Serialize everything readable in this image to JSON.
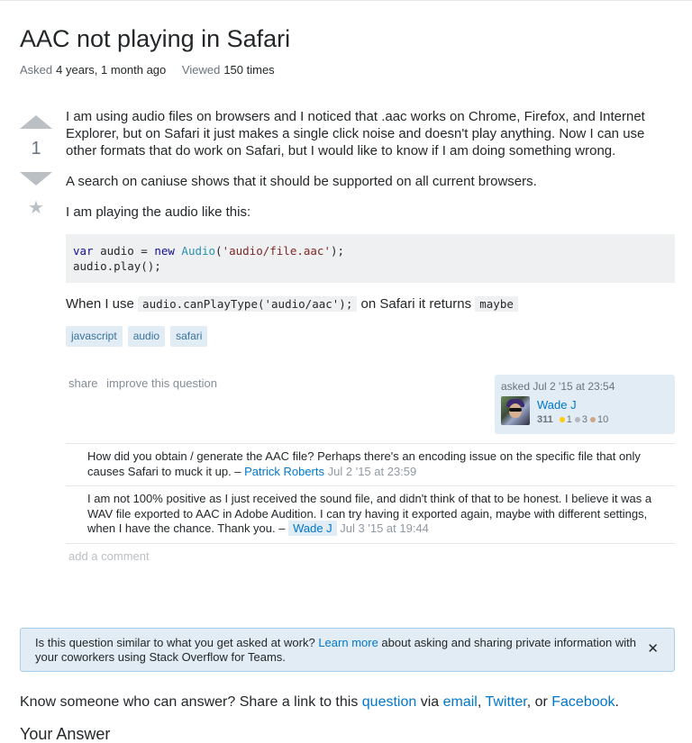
{
  "question": {
    "title": "AAC not playing in Safari",
    "asked_label": "Asked",
    "asked_value": "4 years, 1 month ago",
    "viewed_label": "Viewed",
    "viewed_value": "150 times",
    "votes": "1",
    "body": {
      "p1": "I am using audio files on browsers and I noticed that .aac works on Chrome, Firefox, and Internet Explorer, but on Safari it just makes a single click noise and doesn't play anything. Now I can use other formats that do work on Safari, but I would like to know if I am doing something wrong.",
      "p2": "A search on caniuse shows that it should be supported on all current browsers.",
      "p3": "I am playing the audio like this:",
      "code_kw1": "var",
      "code_l1a": " audio = ",
      "code_kw2": "new",
      "code_cls": " Audio",
      "code_l1b": "(",
      "code_str": "'audio/file.aac'",
      "code_l1c": ");",
      "code_l2": "audio.play();",
      "p4_pre": "When I use ",
      "p4_code1": "audio.canPlayType('audio/aac');",
      "p4_mid": " on Safari it returns ",
      "p4_code2": "maybe"
    },
    "tags": [
      "javascript",
      "audio",
      "safari"
    ],
    "menu": {
      "share": "share",
      "improve": "improve this question"
    },
    "owner": {
      "asked_text": "asked Jul 2 '15 at 23:54",
      "name": "Wade J",
      "reputation": "311",
      "gold": "1",
      "silver": "3",
      "bronze": "10",
      "gold_color": "#ffcc01",
      "silver_color": "#b4b8bc",
      "bronze_color": "#d1a684"
    }
  },
  "comments": [
    {
      "text": "How did you obtain / generate the AAC file? Perhaps there's an encoding issue on the specific file that only causes Safari to muck it up. – ",
      "user": "Patrick Roberts",
      "date": "Jul 2 '15 at 23:59"
    },
    {
      "text": "I am not 100% positive as I just received the sound file, and didn't think of that to be honest. I believe it was a WAV file exported to AAC in Adobe Audition. I can try having it exported again, maybe with different settings, when I have the chance. Thank you. – ",
      "user": "Wade J",
      "date": "Jul 3 '15 at 19:44"
    }
  ],
  "add_comment": "add a comment",
  "notice": {
    "pre": "Is this question similar to what you get asked at work? ",
    "link": "Learn more",
    "post": " about asking and sharing private information with your coworkers using Stack Overflow for Teams.",
    "close": "✕"
  },
  "share_line": {
    "pre": "Know someone who can answer? Share a link to this ",
    "question": "question",
    "via": " via ",
    "email": "email",
    "comma1": ", ",
    "twitter": "Twitter",
    "or": ", or ",
    "facebook": "Facebook",
    "end": "."
  },
  "your_answer": "Your Answer",
  "colors": {
    "link": "#0077cc",
    "tag_bg": "#e1ecf4",
    "tag_text": "#39739d"
  }
}
